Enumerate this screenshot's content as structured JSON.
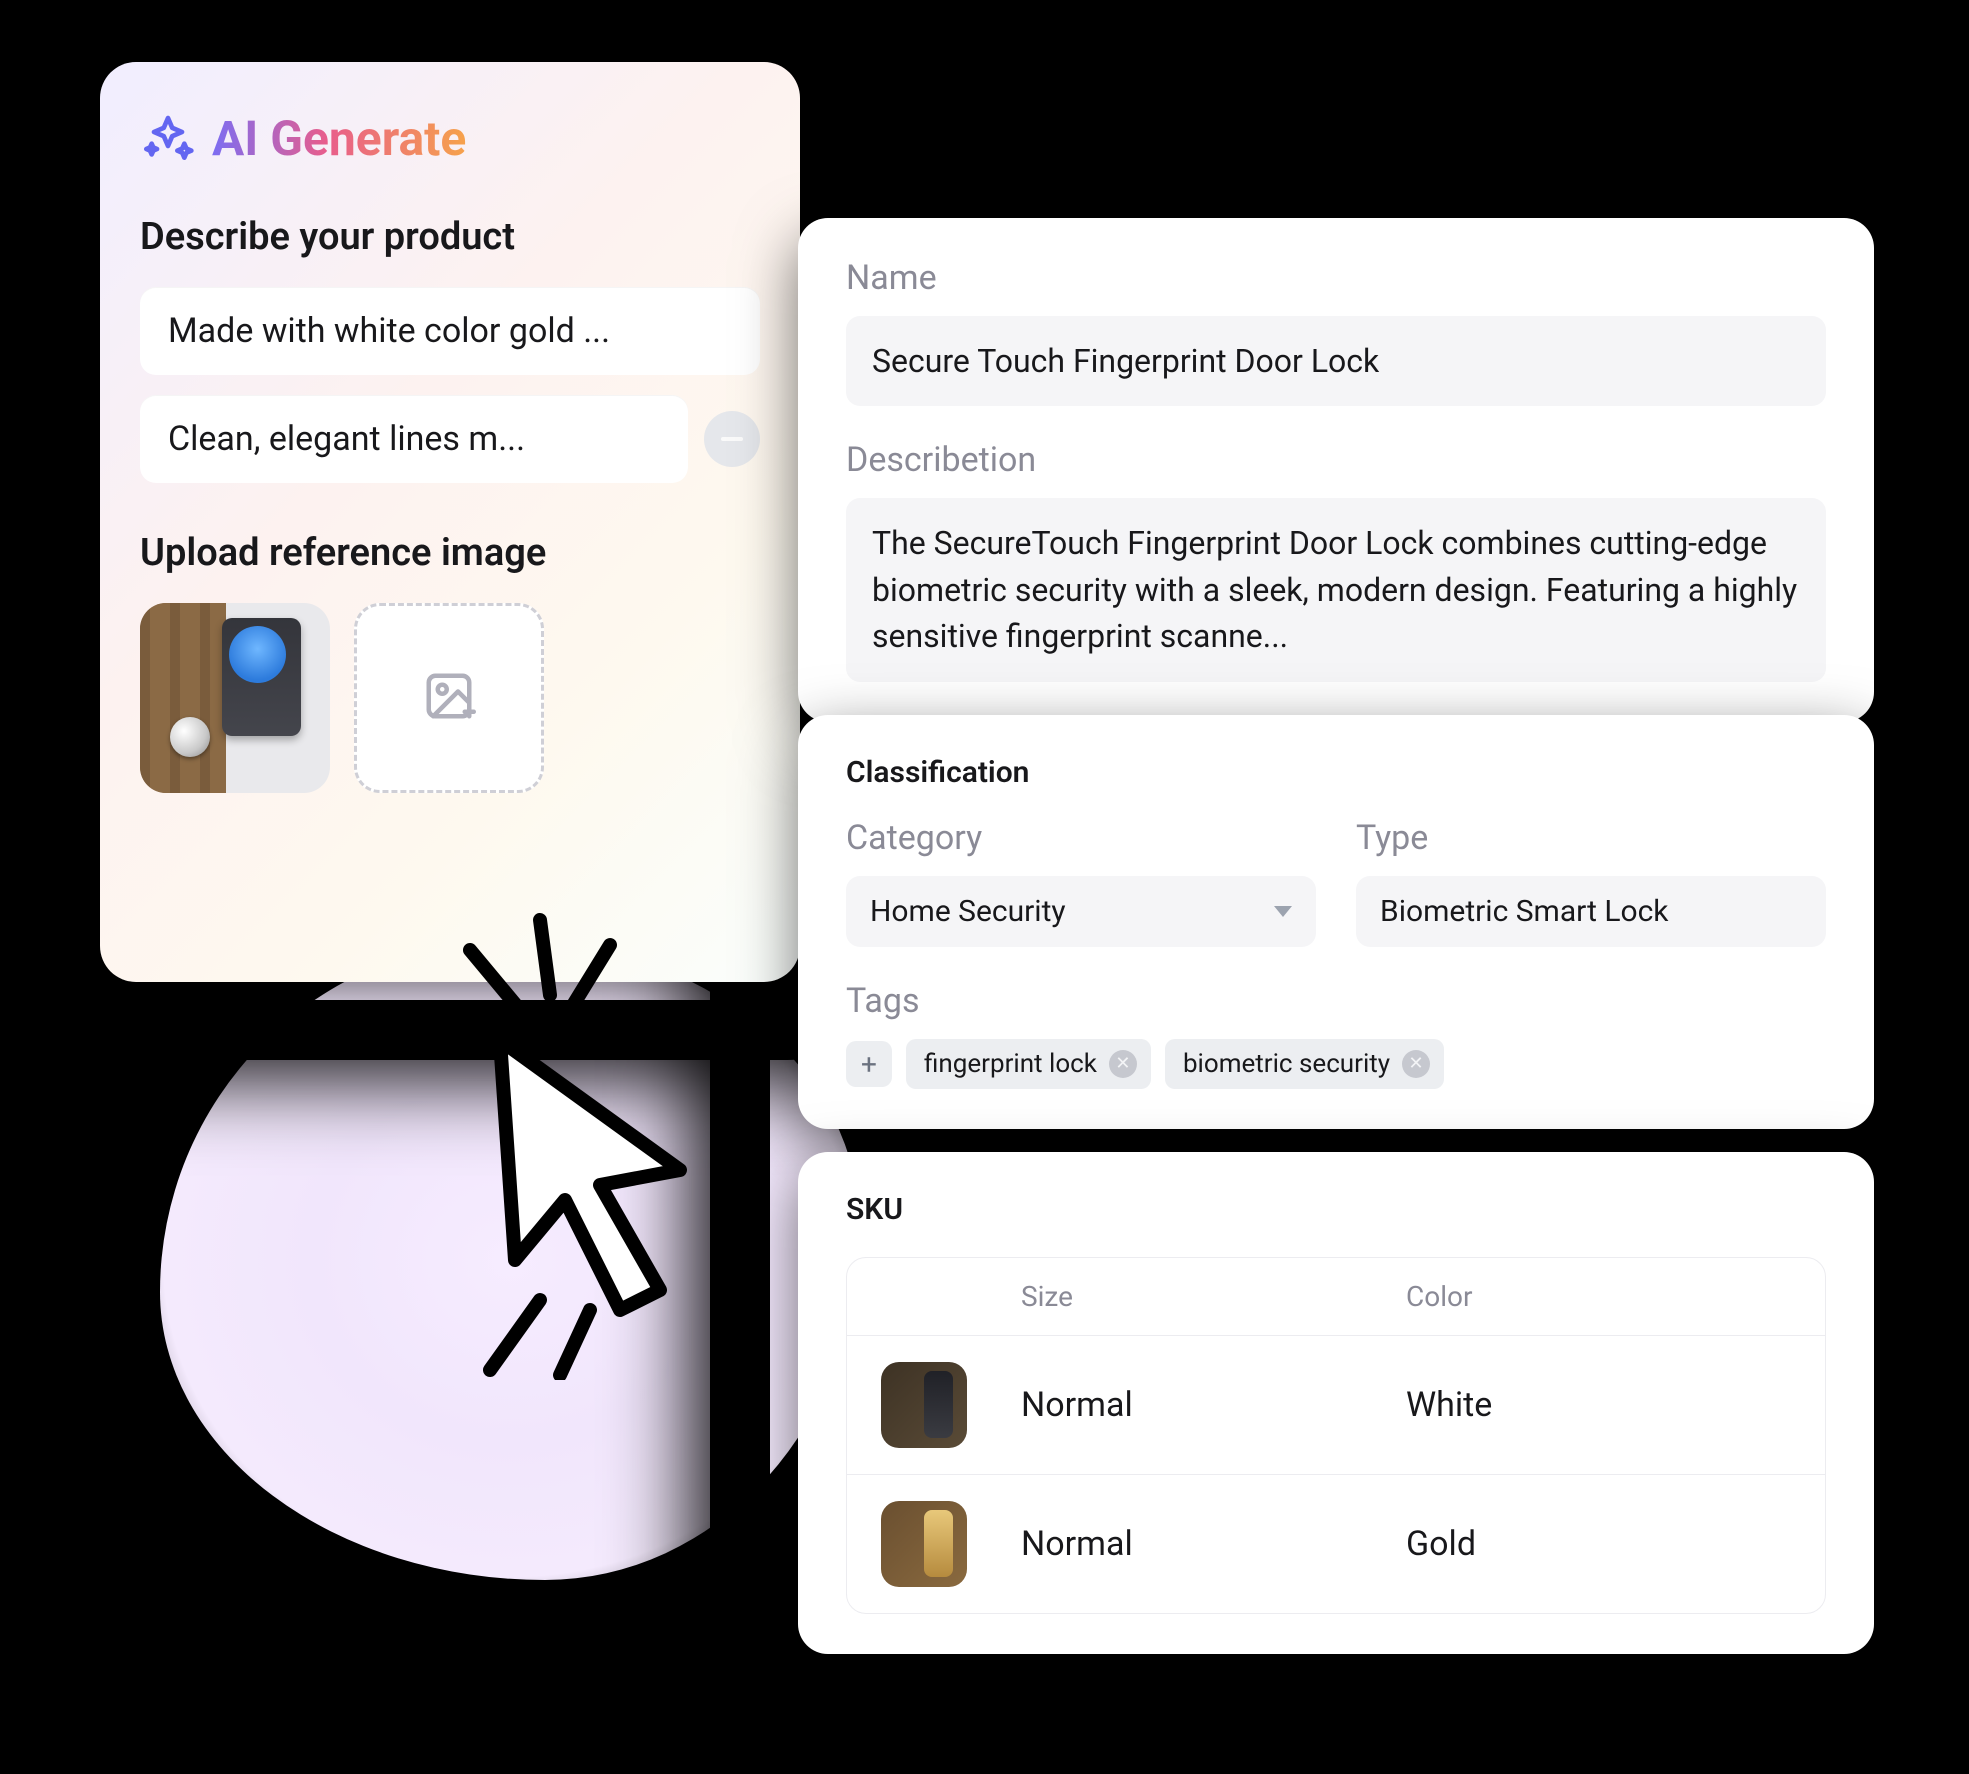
{
  "ai": {
    "title": "AI Generate",
    "describe_label": "Describe your product",
    "prompts": [
      "Made with white color gold ...",
      "Clean, elegant lines m..."
    ],
    "upload_label": "Upload reference image"
  },
  "details": {
    "name_label": "Name",
    "name_value": "Secure Touch Fingerprint Door Lock",
    "desc_label": "Describetion",
    "desc_value": "The SecureTouch Fingerprint Door Lock combines cutting-edge biometric security with a sleek, modern design. Featuring a highly sensitive fingerprint scanne..."
  },
  "classification": {
    "heading": "Classification",
    "category_label": "Category",
    "category_value": "Home Security",
    "type_label": "Type",
    "type_value": "Biometric Smart Lock",
    "tags_label": "Tags",
    "tags": [
      "fingerprint lock",
      "biometric security"
    ]
  },
  "sku": {
    "heading": "SKU",
    "columns": {
      "size": "Size",
      "color": "Color"
    },
    "rows": [
      {
        "size": "Normal",
        "color": "White",
        "swatch": "white"
      },
      {
        "size": "Normal",
        "color": "Gold",
        "swatch": "gold"
      }
    ]
  }
}
